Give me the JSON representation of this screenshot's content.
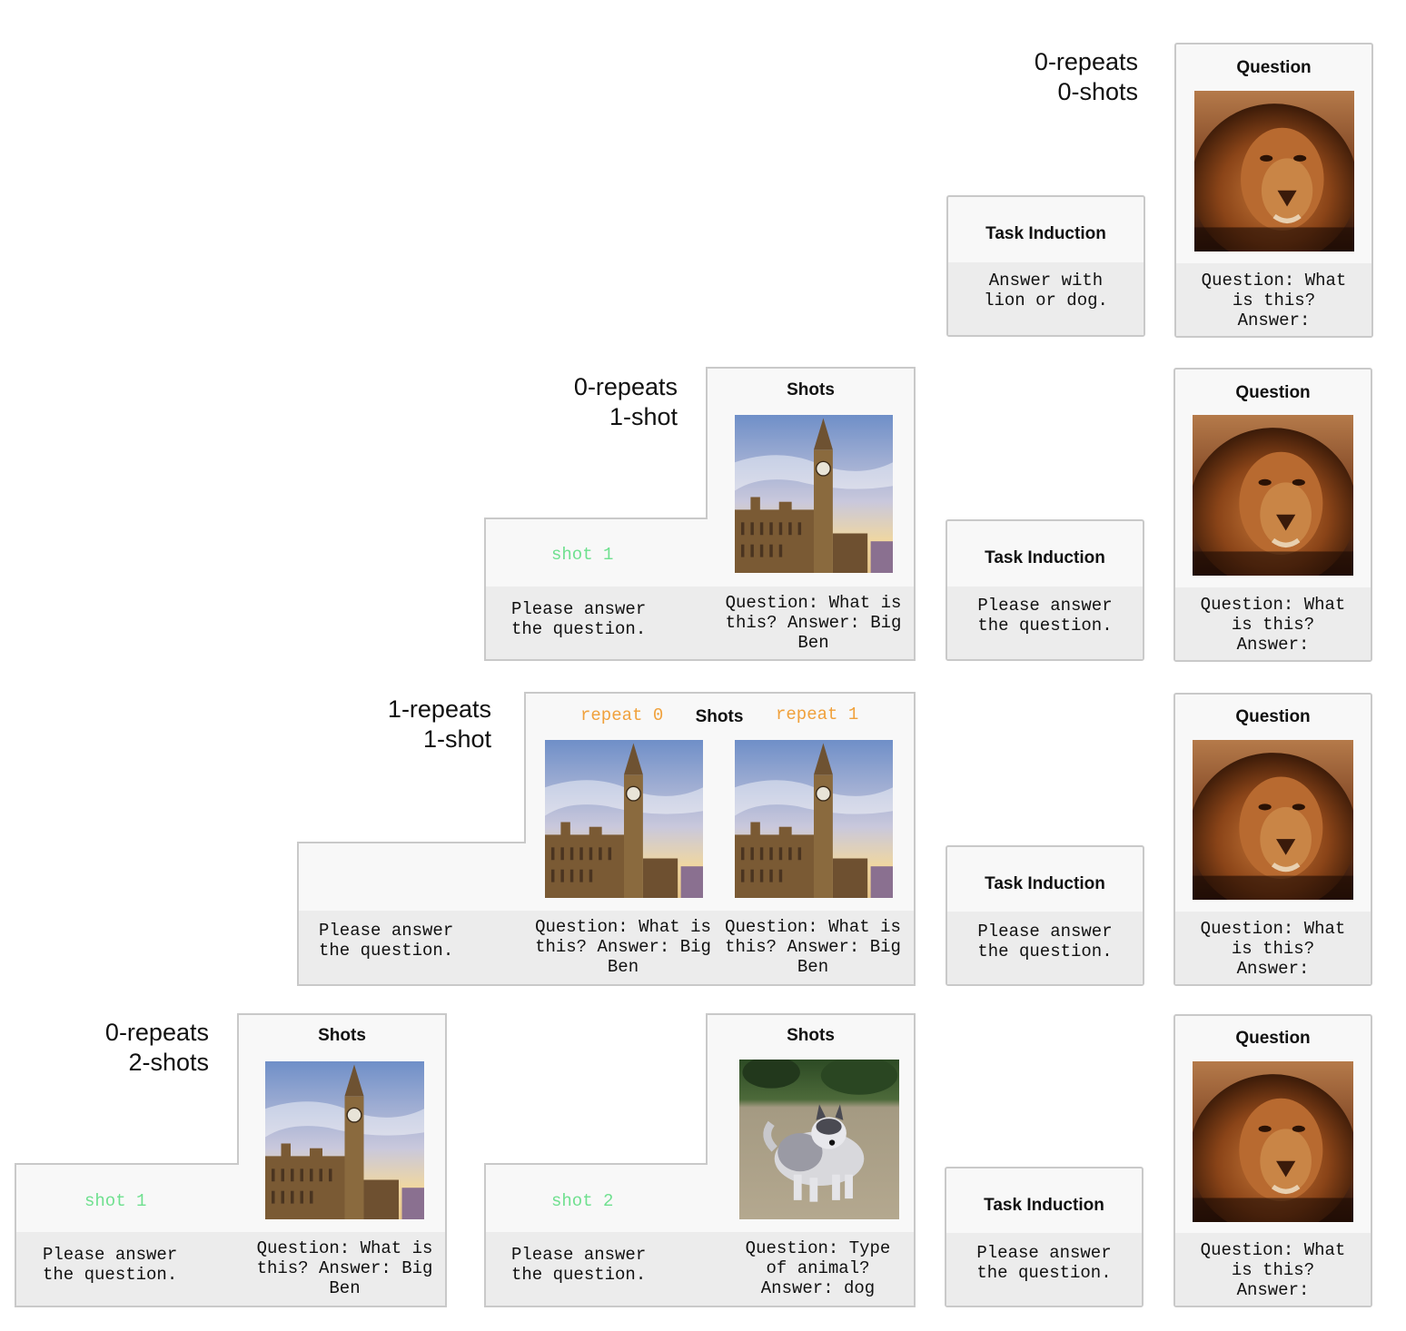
{
  "rows": [
    {
      "label_line1": "0-repeats",
      "label_line2": "0-shots"
    },
    {
      "label_line1": "0-repeats",
      "label_line2": "1-shot"
    },
    {
      "label_line1": "1-repeats",
      "label_line2": "1-shot"
    },
    {
      "label_line1": "0-repeats",
      "label_line2": "2-shots"
    }
  ],
  "headers": {
    "question": "Question",
    "task_induction": "Task Induction",
    "shots": "Shots"
  },
  "text": {
    "question_prompt": "Question: What\nis this?\nAnswer:",
    "task_induction_row0": "Answer with\nlion or dog.",
    "task_induction_other": "Please answer\nthe question.",
    "please_answer": "Please answer\nthe question.",
    "big_ben_answer": "Question: What is\nthis? Answer: Big\nBen",
    "dog_answer": "Question: Type\nof animal?\nAnswer: dog"
  },
  "tags": {
    "shot1": "shot 1",
    "shot2": "shot 2",
    "repeat0": "repeat 0",
    "repeat1": "repeat 1"
  },
  "images": {
    "lion": "lion-photo",
    "big_ben": "big-ben-photo",
    "dog": "dog-photo"
  },
  "colors": {
    "shot_tag": "#6fe08f",
    "repeat_tag": "#f0a13c",
    "panel_border": "#c9c9c9",
    "panel_bg": "#f8f8f8",
    "text_strip": "#ececec"
  }
}
